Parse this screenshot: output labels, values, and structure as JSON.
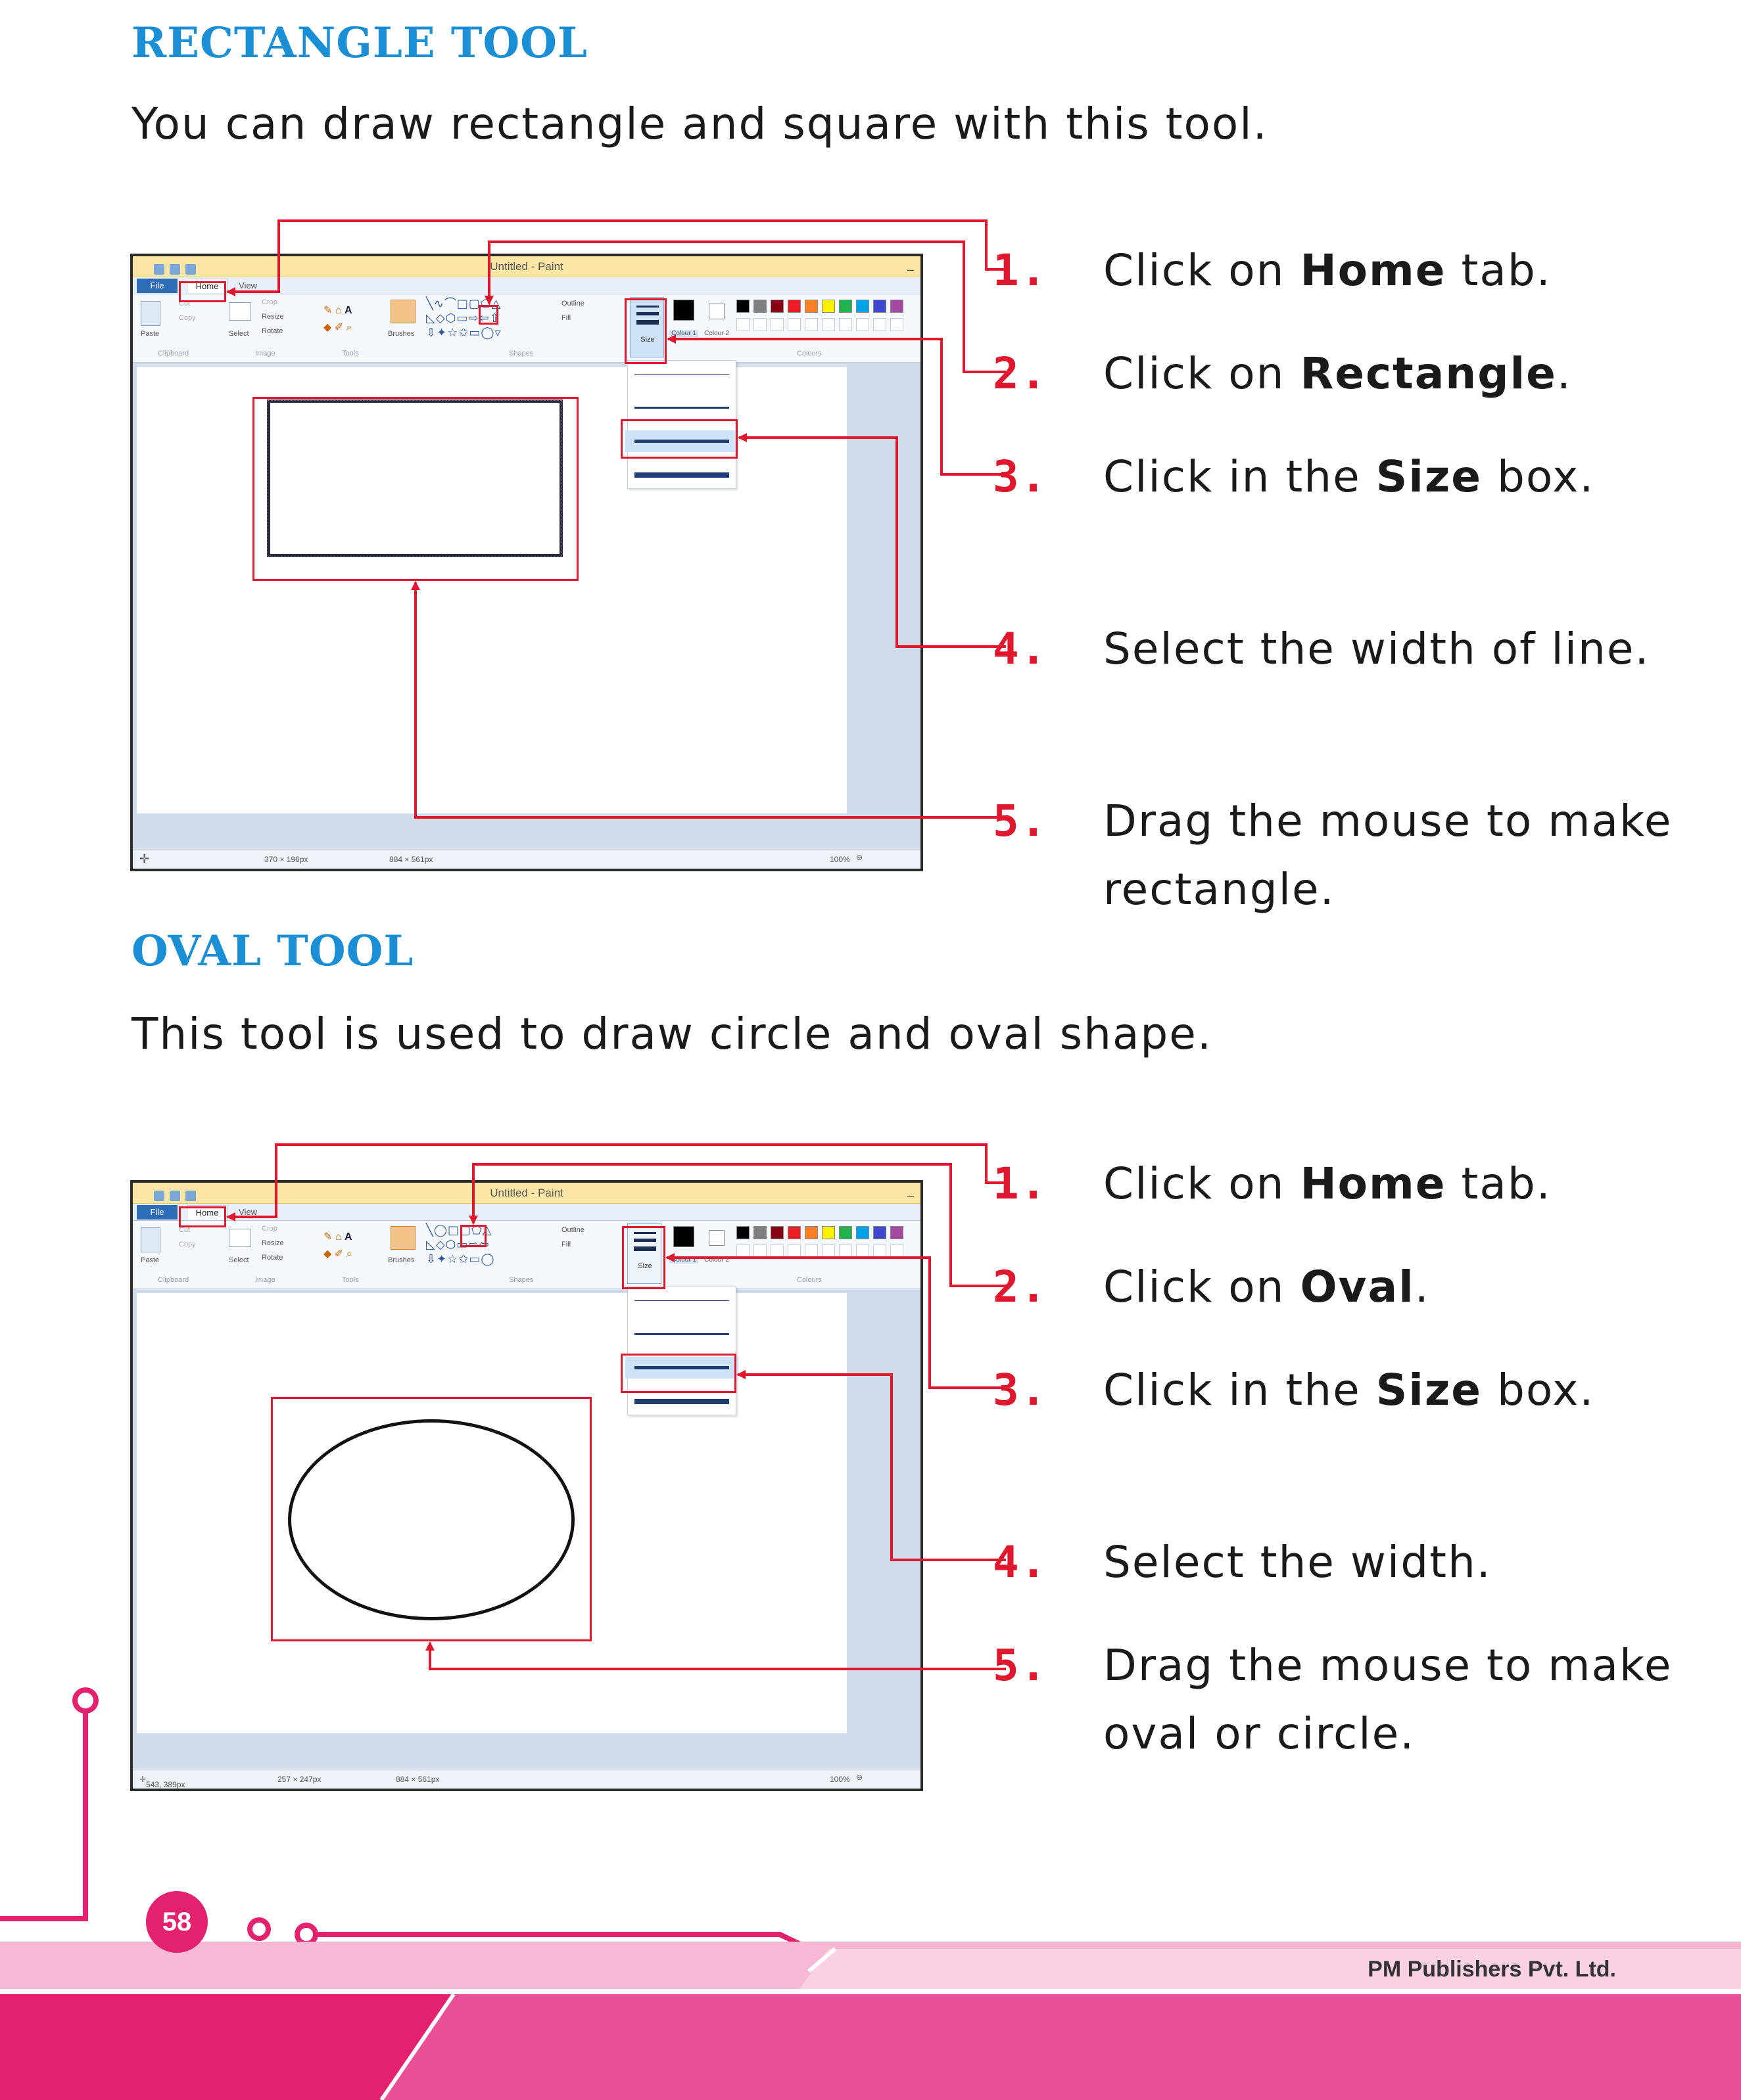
{
  "rectangle_section": {
    "heading": "RECTANGLE TOOL",
    "intro": "You can draw rectangle and square with this tool.",
    "steps": [
      {
        "num": "1.",
        "pre": "Click on ",
        "bold": "Home",
        "post": " tab."
      },
      {
        "num": "2.",
        "pre": "Click on ",
        "bold": "Rectangle",
        "post": "."
      },
      {
        "num": "3.",
        "pre": "Click in the ",
        "bold": "Size",
        "post": " box."
      },
      {
        "num": "4.",
        "pre": "Select the width of line.",
        "bold": "",
        "post": ""
      },
      {
        "num": "5.",
        "pre": "Drag the mouse to make rectangle.",
        "bold": "",
        "post": ""
      }
    ],
    "window": {
      "title": "Untitled - Paint",
      "status_selection": "370 × 196px",
      "status_canvas": "884 × 561px",
      "status_zoom": "100%"
    }
  },
  "oval_section": {
    "heading": "OVAL TOOL",
    "intro": "This tool is used to draw circle and oval shape.",
    "steps": [
      {
        "num": "1.",
        "pre": "Click on ",
        "bold": "Home",
        "post": " tab."
      },
      {
        "num": "2.",
        "pre": "Click on ",
        "bold": "Oval",
        "post": "."
      },
      {
        "num": "3.",
        "pre": "Click in the ",
        "bold": "Size",
        "post": " box."
      },
      {
        "num": "4.",
        "pre": "Select the width.",
        "bold": "",
        "post": ""
      },
      {
        "num": "5.",
        "pre": "Drag the mouse to make oval or circle.",
        "bold": "",
        "post": ""
      }
    ],
    "window": {
      "title": "Untitled - Paint",
      "status_cursor": "543, 389px",
      "status_selection": "257 × 247px",
      "status_canvas": "884 × 561px",
      "status_zoom": "100%"
    }
  },
  "paint_ui": {
    "tab_file": "File",
    "tab_home": "Home",
    "tab_view": "View",
    "paste": "Paste",
    "cut": "Cut",
    "copy": "Copy",
    "select": "Select",
    "crop": "Crop",
    "resize": "Resize",
    "rotate": "Rotate",
    "brushes": "Brushes",
    "outline": "Outline",
    "fill": "Fill",
    "size": "Size",
    "colour1": "Colour 1",
    "colour2": "Colour 2",
    "group_clipboard": "Clipboard",
    "group_image": "Image",
    "group_tools": "Tools",
    "group_shapes": "Shapes",
    "group_colours": "Colours",
    "palette": [
      "#000000",
      "#7f7f7f",
      "#880015",
      "#ed1c24",
      "#ff7f27",
      "#fff200",
      "#22b14c",
      "#00a2e8",
      "#3f48cc",
      "#a349a4"
    ]
  },
  "footer": {
    "page_number": "58",
    "publisher": "PM Publishers Pvt. Ltd."
  },
  "colors": {
    "heading": "#1b8fd6",
    "step_number": "#e0182d",
    "callout": "#e0182d",
    "footer_pink": "#ea4e97"
  }
}
